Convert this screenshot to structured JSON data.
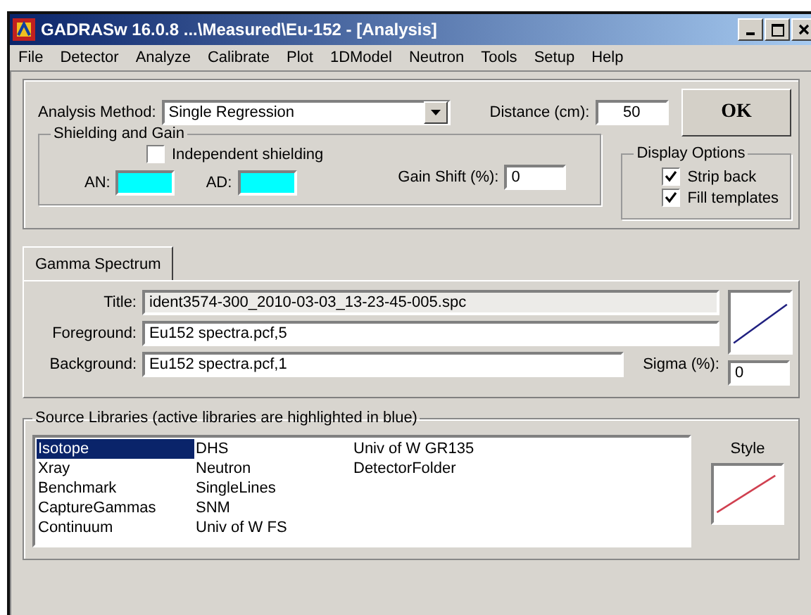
{
  "window": {
    "title": "GADRASw 16.0.8 ...\\Measured\\Eu-152 - [Analysis]"
  },
  "menu": [
    "File",
    "Detector",
    "Analyze",
    "Calibrate",
    "Plot",
    "1DModel",
    "Neutron",
    "Tools",
    "Setup",
    "Help"
  ],
  "analysis_method": {
    "label": "Analysis Method:",
    "value": "Single Regression"
  },
  "distance": {
    "label": "Distance (cm):",
    "value": "50"
  },
  "ok_button": "OK",
  "shielding": {
    "title": "Shielding and Gain",
    "independent": {
      "label": "Independent shielding",
      "checked": false
    },
    "an_label": "AN:",
    "ad_label": "AD:",
    "gain_label": "Gain Shift (%):",
    "gain_value": "0"
  },
  "display_options": {
    "title": "Display Options",
    "options": [
      {
        "label": "Strip back",
        "checked": true
      },
      {
        "label": "Fill templates",
        "checked": true
      }
    ]
  },
  "tabs": [
    {
      "label": "Gamma Spectrum",
      "selected": true
    }
  ],
  "spectrum": {
    "title_label": "Title:",
    "title_value": "ident3574-300_2010-03-03_13-23-45-005.spc",
    "foreground_label": "Foreground:",
    "foreground_value": "Eu152 spectra.pcf,5",
    "background_label": "Background:",
    "background_value": "Eu152 spectra.pcf,1",
    "sigma_label": "Sigma (%):",
    "sigma_value": "0"
  },
  "libraries": {
    "title": "Source Libraries (active libraries are highlighted in blue)",
    "style_label": "Style",
    "columns": [
      [
        {
          "label": "Isotope",
          "selected": true
        },
        {
          "label": "Xray",
          "selected": false
        },
        {
          "label": "Benchmark",
          "selected": false
        },
        {
          "label": "CaptureGammas",
          "selected": false
        },
        {
          "label": "Continuum",
          "selected": false
        }
      ],
      [
        {
          "label": "DHS",
          "selected": false
        },
        {
          "label": "Neutron",
          "selected": false
        },
        {
          "label": "SingleLines",
          "selected": false
        },
        {
          "label": "SNM",
          "selected": false
        },
        {
          "label": "Univ of W FS",
          "selected": false
        }
      ],
      [
        {
          "label": "Univ of W GR135",
          "selected": false
        },
        {
          "label": "DetectorFolder",
          "selected": false
        }
      ]
    ]
  }
}
